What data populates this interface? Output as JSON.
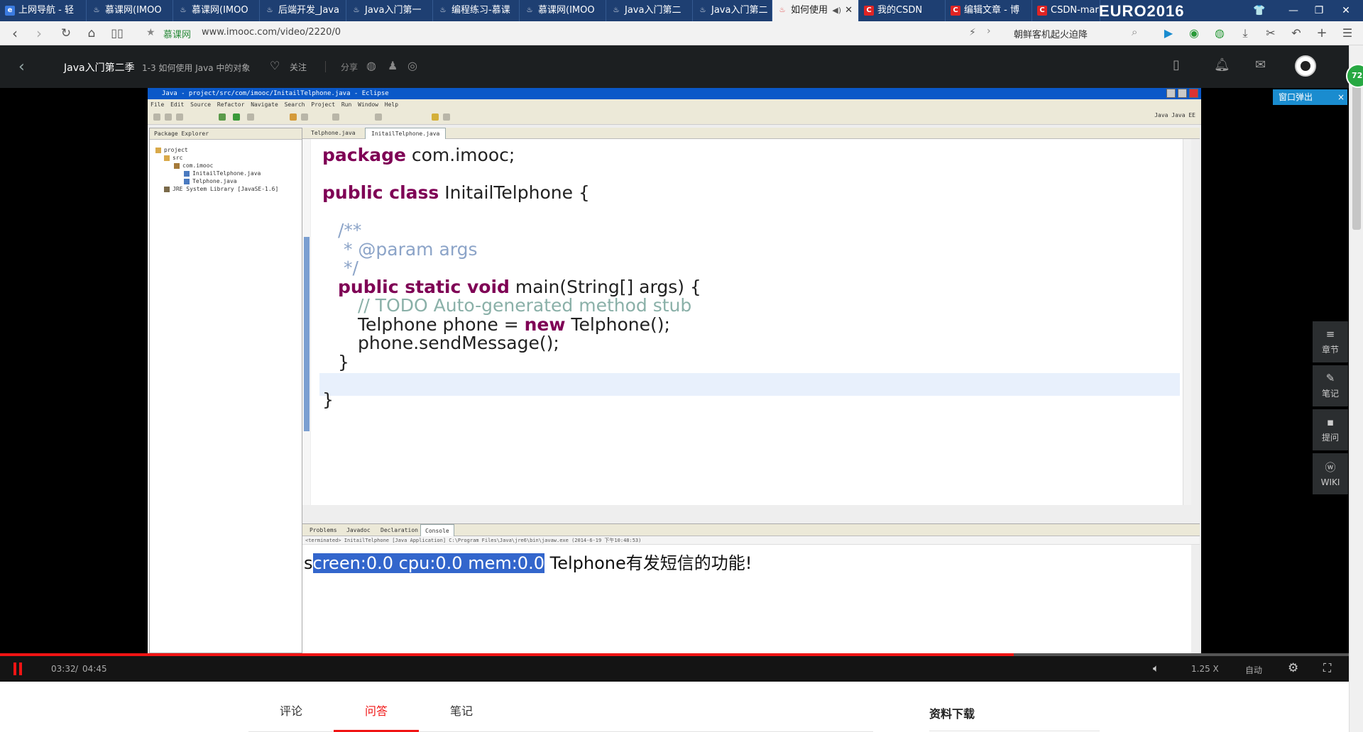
{
  "browser": {
    "tabs": [
      {
        "label": "上网导航 - 轻",
        "icon": "qq-browser-icon"
      },
      {
        "label": "慕课网(IMOO",
        "icon": "flame-icon"
      },
      {
        "label": "慕课网(IMOO",
        "icon": "flame-icon"
      },
      {
        "label": "后端开发_Java",
        "icon": "flame-icon"
      },
      {
        "label": "Java入门第一",
        "icon": "flame-icon"
      },
      {
        "label": "编程练习-慕课",
        "icon": "flame-icon"
      },
      {
        "label": "慕课网(IMOO",
        "icon": "flame-icon"
      },
      {
        "label": "Java入门第二",
        "icon": "flame-icon"
      },
      {
        "label": "Java入门第二",
        "icon": "flame-icon"
      },
      {
        "label": "如何使用",
        "icon": "flame-icon",
        "active": true
      },
      {
        "label": "我的CSDN",
        "icon": "csdn-icon"
      },
      {
        "label": "编辑文章 - 博",
        "icon": "csdn-icon"
      },
      {
        "label": "CSDN-mark",
        "icon": "csdn-icon"
      }
    ],
    "euro_banner": "EURO2016",
    "site_name": "慕课网",
    "url": "www.imooc.com/video/2220/0",
    "news_ticker": "朝鲜客机起火迫降"
  },
  "site_header": {
    "course_title": "Java入门第二季",
    "lesson_title": "1-3 如何使用 Java 中的对象",
    "follow_label": "关注",
    "share_label": "分享"
  },
  "eclipse": {
    "window_title": "Java - project/src/com/imooc/InitailTelphone.java - Eclipse",
    "menu": "File Edit Source Refactor Navigate Search Project Run Window Help",
    "perspectives": "Java  Java EE",
    "package_explorer_tab": "Package Explorer",
    "tree": [
      "project",
      "src",
      "com.imooc",
      "InitailTelphone.java",
      "Telphone.java",
      "JRE System Library [JavaSE-1.6]"
    ],
    "editor_tabs": [
      "Telphone.java",
      "InitailTelphone.java"
    ],
    "code": {
      "l1_kw": "package",
      "l1_rest": " com.imooc;",
      "l2_kw": "public class",
      "l2_rest": " InitailTelphone {",
      "l3": "/**",
      "l4": " * @param args",
      "l5": " */",
      "l6_kw": "public static void",
      "l6_rest": " main(String[] args) {",
      "l7_todo": "// TODO Auto-generated method stub",
      "l8_pre": "Telphone phone = ",
      "l8_kw": "new",
      "l8_post": " Telphone();",
      "l9": "phone.sendMessage();",
      "l10": "}",
      "l11": "}"
    },
    "console_tabs": [
      "Problems",
      "Javadoc",
      "Declaration",
      "Console"
    ],
    "console_status": "<terminated> InitailTelphone [Java Application] C:\\Program Files\\Java\\jre6\\bin\\javaw.exe (2014-6-19 下午10:48:53)",
    "console_output_first": "s",
    "console_output_selected": "creen:0.0 cpu:0.0 mem:0.0",
    "console_output_rest": " Telphone有发短信的功能!"
  },
  "popup": {
    "label": "窗口弹出",
    "close": "×"
  },
  "side_panel": [
    {
      "icon": "list-icon",
      "label": "章节"
    },
    {
      "icon": "pencil-icon",
      "label": "笔记"
    },
    {
      "icon": "comment-icon",
      "label": "提问"
    },
    {
      "icon": "wiki-icon",
      "label": "WIKI"
    }
  ],
  "player": {
    "current_time": "03:32",
    "separator": "/",
    "total_time": "04:45",
    "progress": 0.744,
    "speed": "1.25 X",
    "quality": "自动"
  },
  "page_tabs": {
    "tabs": [
      "评论",
      "问答",
      "笔记"
    ],
    "active_index": 1,
    "downloads_title": "资料下载"
  },
  "cpu_badge": "72",
  "colors": {
    "accent": "#f01414",
    "header_bg": "#1c1f21",
    "tabbar_bg": "#1e3f72",
    "keyword": "#7f0055"
  }
}
